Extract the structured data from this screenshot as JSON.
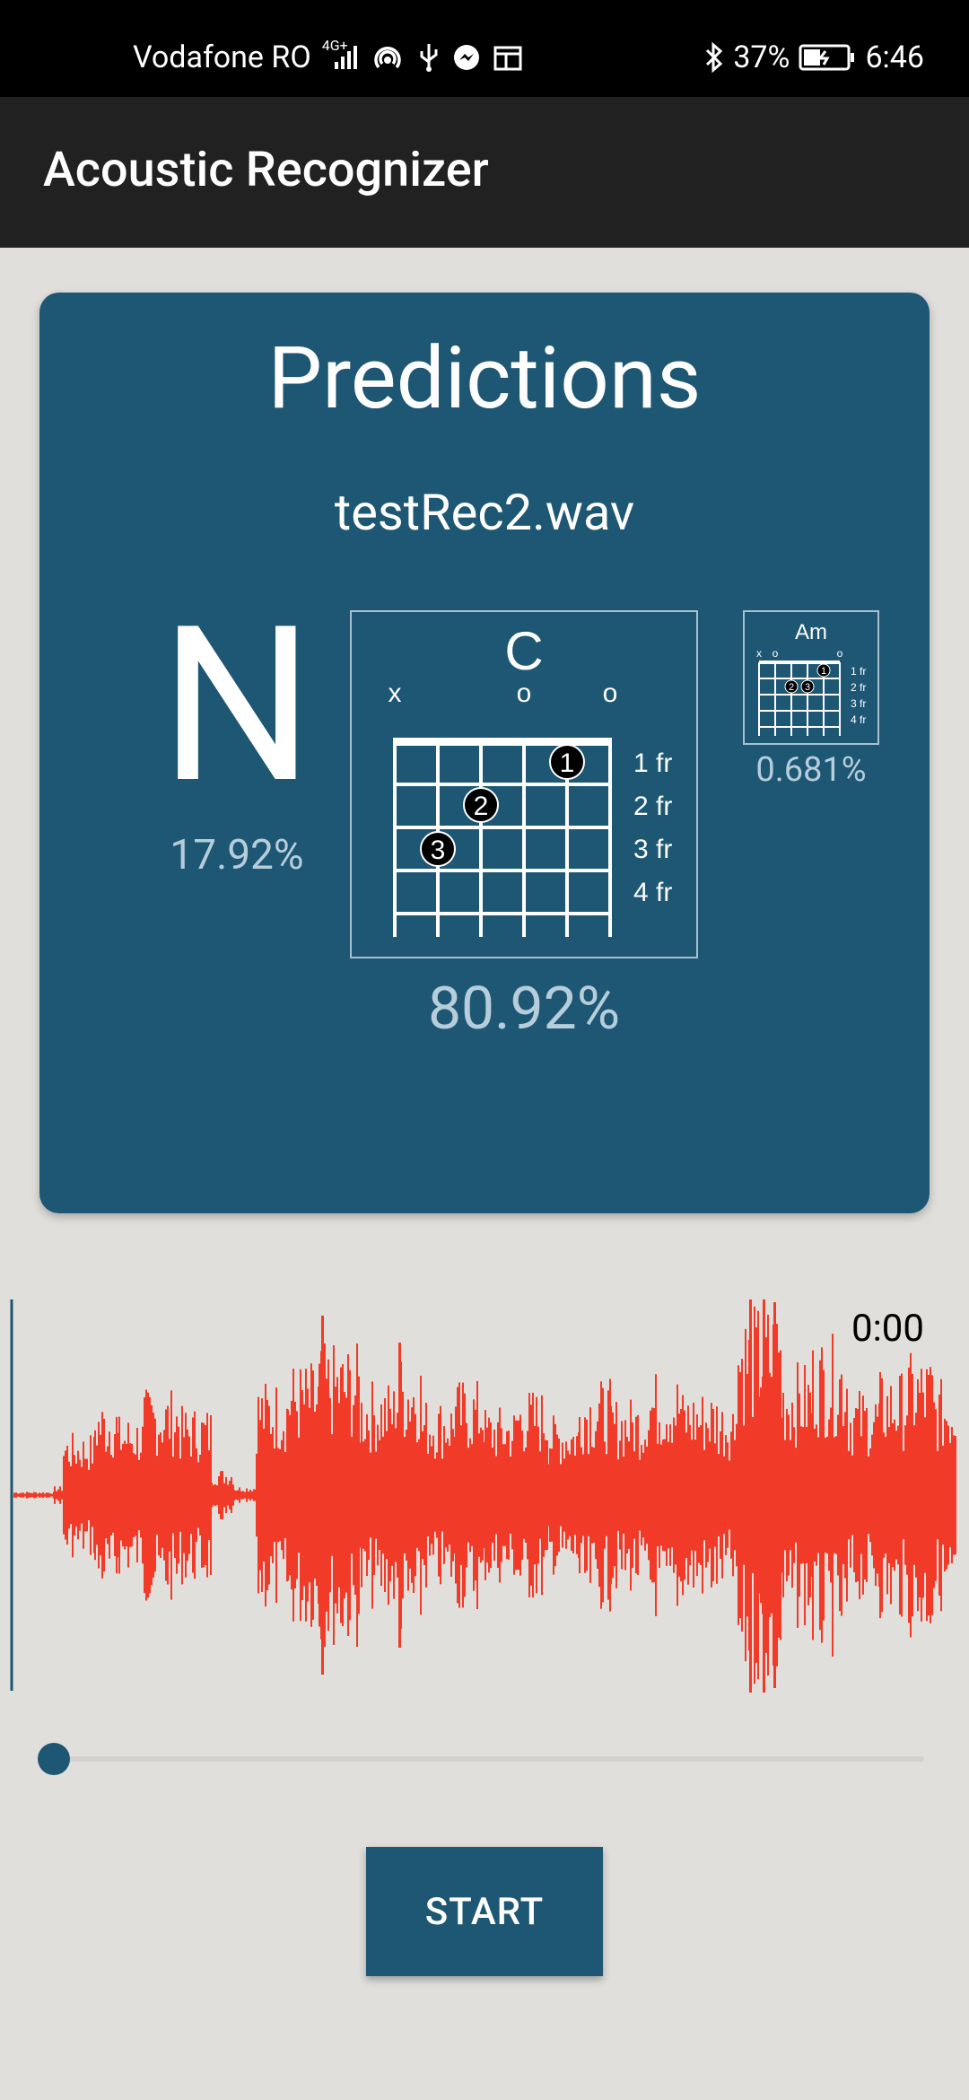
{
  "status_bar": {
    "carrier": "Vodafone RO",
    "network": "4G+",
    "battery": "37%",
    "time": "6:46"
  },
  "app_bar": {
    "title": "Acoustic Recognizer"
  },
  "predictions": {
    "title": "Predictions",
    "filename": "testRec2.wav",
    "left": {
      "label": "N",
      "percent": "17.92%"
    },
    "main": {
      "chord": "C",
      "percent": "80.92%",
      "top_markers": [
        "x",
        "o",
        "o"
      ],
      "frets": [
        "1 fr",
        "2 fr",
        "3 fr",
        "4 fr"
      ],
      "fingers": [
        "1",
        "2",
        "3"
      ]
    },
    "right": {
      "chord": "Am",
      "percent": "0.681%",
      "top_markers": [
        "x",
        "o",
        "o"
      ],
      "frets": [
        "1 fr",
        "2 fr",
        "3 fr",
        "4 fr"
      ],
      "fingers": [
        "1",
        "2",
        "3"
      ]
    }
  },
  "player": {
    "time": "0:00",
    "waveform_color": "#f23a28",
    "progress": 0
  },
  "start_button": {
    "label": "START"
  },
  "colors": {
    "primary": "#1d5773",
    "background": "#e0dfdb",
    "app_bar": "#212121",
    "secondary_text": "#b6cddb"
  }
}
